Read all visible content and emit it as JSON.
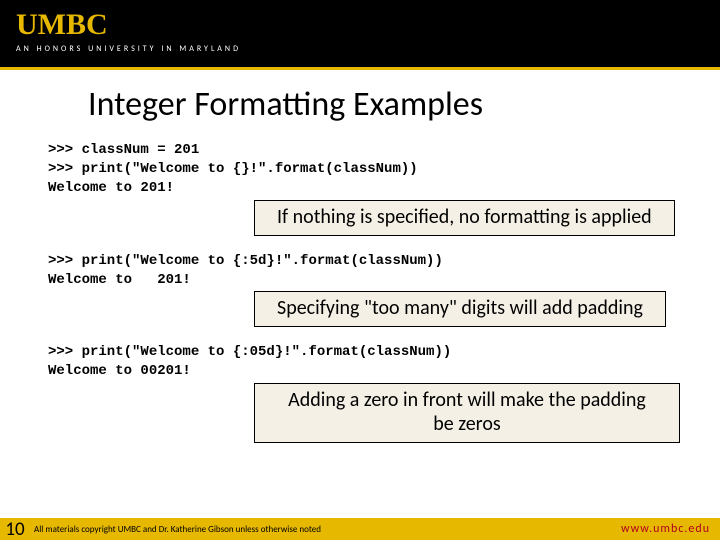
{
  "header": {
    "logo": "UMBC",
    "tagline": "AN HONORS UNIVERSITY IN MARYLAND"
  },
  "title": "Integer Formatting Examples",
  "examples": [
    {
      "code": ">>> classNum = 201\n>>> print(\"Welcome to {}!\".format(classNum))\nWelcome to 201!",
      "note": "If nothing is specified, no formatting is applied"
    },
    {
      "code": ">>> print(\"Welcome to {:5d}!\".format(classNum))\nWelcome to   201!",
      "note": "Specifying \"too many\" digits will add padding"
    },
    {
      "code": ">>> print(\"Welcome to {:05d}!\".format(classNum))\nWelcome to 00201!",
      "note": "Adding a zero in front will make the padding be zeros"
    }
  ],
  "footer": {
    "slideNumber": "10",
    "copyright": "All materials copyright UMBC and Dr. Katherine Gibson unless otherwise noted",
    "url": "www.umbc.edu"
  }
}
